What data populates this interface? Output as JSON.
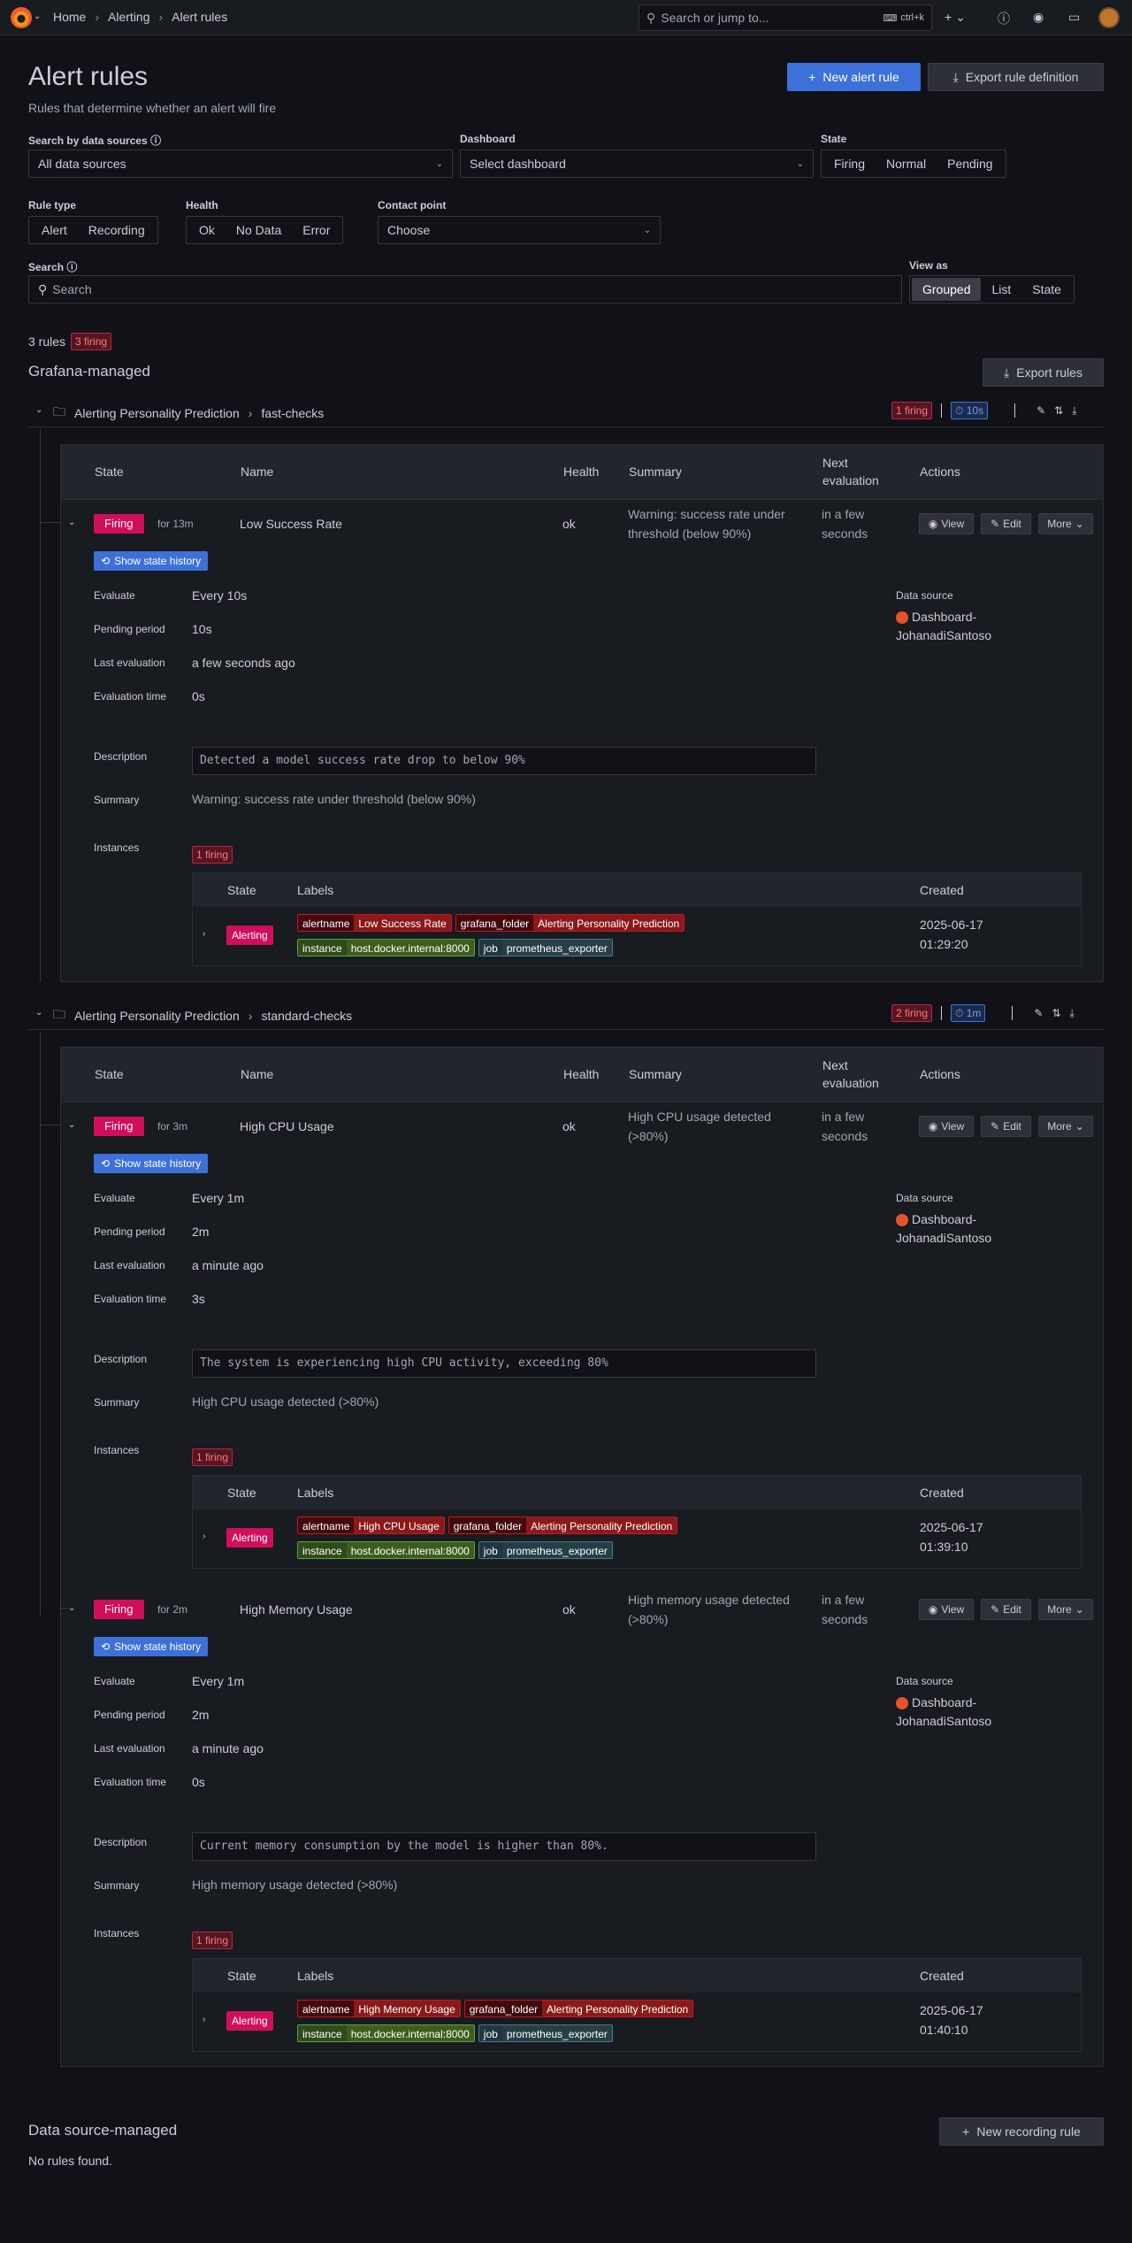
{
  "breadcrumb": {
    "home": "Home",
    "alerting": "Alerting",
    "current": "Alert rules"
  },
  "topsearch": {
    "placeholder": "Search or jump to...",
    "shortcut": "ctrl+k"
  },
  "header": {
    "title": "Alert rules",
    "subtitle": "Rules that determine whether an alert will fire",
    "new_rule": "New alert rule",
    "export_def": "Export rule definition"
  },
  "filters": {
    "datasources_label": "Search by data sources",
    "datasources_value": "All data sources",
    "dashboard_label": "Dashboard",
    "dashboard_placeholder": "Select dashboard",
    "state_label": "State",
    "state_options": [
      "Firing",
      "Normal",
      "Pending"
    ],
    "ruletype_label": "Rule type",
    "ruletype_options": [
      "Alert",
      "Recording"
    ],
    "health_label": "Health",
    "health_options": [
      "Ok",
      "No Data",
      "Error"
    ],
    "contact_label": "Contact point",
    "contact_placeholder": "Choose",
    "search_label": "Search",
    "search_placeholder": "Search",
    "viewas_label": "View as",
    "viewas_options": [
      "Grouped",
      "List",
      "State"
    ]
  },
  "summary": {
    "rules": "3 rules",
    "firing": "3 firing"
  },
  "grafana_managed": {
    "title": "Grafana-managed",
    "export": "Export rules",
    "table_headers": {
      "state": "State",
      "name": "Name",
      "health": "Health",
      "summary": "Summary",
      "next": "Next evaluation",
      "actions": "Actions"
    },
    "detail_labels": {
      "evaluate": "Evaluate",
      "pending": "Pending period",
      "last": "Last evaluation",
      "evaltime": "Evaluation time",
      "datasource": "Data source",
      "description": "Description",
      "summary": "Summary",
      "instances": "Instances"
    },
    "instance_headers": {
      "state": "State",
      "labels": "Labels",
      "created": "Created"
    },
    "action_labels": {
      "view": "View",
      "edit": "Edit",
      "more": "More",
      "history": "Show state history"
    },
    "groups": [
      {
        "folder": "Alerting Personality Prediction",
        "name": "fast-checks",
        "firing": "1 firing",
        "interval": "10s",
        "rules": [
          {
            "state": "Firing",
            "for": "for 13m",
            "name": "Low Success Rate",
            "health": "ok",
            "summary": "Warning: success rate under threshold (below 90%)",
            "next": "in a few seconds",
            "evaluate": "Every 10s",
            "pending": "10s",
            "last": "a few seconds ago",
            "evaltime": "0s",
            "datasource": "Dashboard-JohanadiSantoso",
            "description": "Detected a model success rate drop to below 90%",
            "instances_firing": "1 firing",
            "instance": {
              "state": "Alerting",
              "alertname": "Low Success Rate",
              "folder": "Alerting Personality Prediction",
              "instance": "host.docker.internal:8000",
              "job": "prometheus_exporter",
              "created_date": "2025-06-17",
              "created_time": "01:29:20"
            }
          }
        ]
      },
      {
        "folder": "Alerting Personality Prediction",
        "name": "standard-checks",
        "firing": "2 firing",
        "interval": "1m",
        "rules": [
          {
            "state": "Firing",
            "for": "for 3m",
            "name": "High CPU Usage",
            "health": "ok",
            "summary": "High CPU usage detected (>80%)",
            "next": "in a few seconds",
            "evaluate": "Every 1m",
            "pending": "2m",
            "last": "a minute ago",
            "evaltime": "3s",
            "datasource": "Dashboard-JohanadiSantoso",
            "description": "The system is experiencing high CPU activity, exceeding 80%",
            "instances_firing": "1 firing",
            "instance": {
              "state": "Alerting",
              "alertname": "High CPU Usage",
              "folder": "Alerting Personality Prediction",
              "instance": "host.docker.internal:8000",
              "job": "prometheus_exporter",
              "created_date": "2025-06-17",
              "created_time": "01:39:10"
            }
          },
          {
            "state": "Firing",
            "for": "for 2m",
            "name": "High Memory Usage",
            "health": "ok",
            "summary": "High memory usage detected (>80%)",
            "next": "in a few seconds",
            "evaluate": "Every 1m",
            "pending": "2m",
            "last": "a minute ago",
            "evaltime": "0s",
            "datasource": "Dashboard-JohanadiSantoso",
            "description": "Current memory consumption by the model is higher than 80%.",
            "instances_firing": "1 firing",
            "instance": {
              "state": "Alerting",
              "alertname": "High Memory Usage",
              "folder": "Alerting Personality Prediction",
              "instance": "host.docker.internal:8000",
              "job": "prometheus_exporter",
              "created_date": "2025-06-17",
              "created_time": "01:40:10"
            }
          }
        ]
      }
    ]
  },
  "label_keys": {
    "alertname": "alertname",
    "folder": "grafana_folder",
    "instance": "instance",
    "job": "job"
  },
  "ds_managed": {
    "title": "Data source-managed",
    "new_recording": "New recording rule",
    "empty": "No rules found."
  }
}
